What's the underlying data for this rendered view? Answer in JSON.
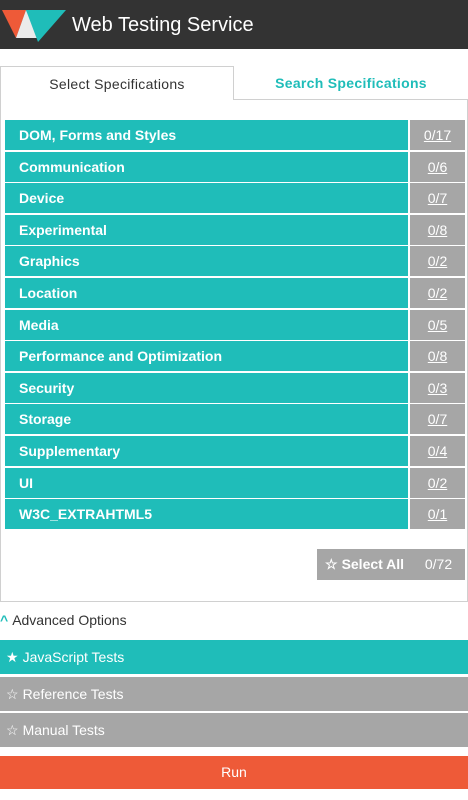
{
  "header": {
    "title": "Web Testing Service"
  },
  "tabs": [
    {
      "label": "Select Specifications",
      "active": true
    },
    {
      "label": "Search Specifications",
      "active": false
    }
  ],
  "specs": [
    {
      "name": "DOM, Forms and Styles",
      "count": "0/17"
    },
    {
      "name": "Communication",
      "count": "0/6"
    },
    {
      "name": "Device",
      "count": "0/7"
    },
    {
      "name": "Experimental",
      "count": "0/8"
    },
    {
      "name": "Graphics",
      "count": "0/2"
    },
    {
      "name": "Location",
      "count": "0/2"
    },
    {
      "name": "Media",
      "count": "0/5"
    },
    {
      "name": "Performance and Optimization",
      "count": "0/8"
    },
    {
      "name": "Security",
      "count": "0/3"
    },
    {
      "name": "Storage",
      "count": "0/7"
    },
    {
      "name": "Supplementary",
      "count": "0/4"
    },
    {
      "name": "UI",
      "count": "0/2"
    },
    {
      "name": "W3C_EXTRAHTML5",
      "count": "0/1"
    }
  ],
  "select_all": {
    "label": "Select All",
    "total": "0/72"
  },
  "advanced": {
    "label": "Advanced Options"
  },
  "test_types": [
    {
      "label": "JavaScript Tests"
    },
    {
      "label": "Reference Tests"
    },
    {
      "label": "Manual Tests"
    }
  ],
  "run": {
    "label": "Run"
  },
  "colors": {
    "header_bg": "#333333",
    "accent_teal": "#1fbdb9",
    "neutral_gray": "#a6a6a6",
    "run_orange": "#ee5a38"
  },
  "icons": {
    "logo": "wts-logo",
    "star": "star-icon",
    "chevron": "chevron-up-icon"
  }
}
